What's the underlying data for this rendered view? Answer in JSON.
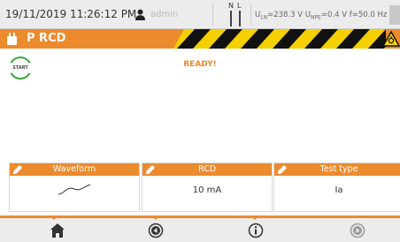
{
  "status_bar": {
    "datetime": "19/11/2019 11:26:12 PM",
    "user": "admin",
    "n_label": "N",
    "l_label": "L",
    "uln_label": "U",
    "uln_sub": "LN",
    "uln_value": "=238.3 V",
    "unpe_label": "U",
    "unpe_sub": "NPE",
    "unpe_value": "=0.4 V",
    "freq": "f=50.0 Hz"
  },
  "title_bar": {
    "title": "P RCD"
  },
  "main": {
    "start_label": "START",
    "status_text": "READY!"
  },
  "params": [
    {
      "label": "Waveform",
      "value": ""
    },
    {
      "label": "RCD",
      "value": "10 mA"
    },
    {
      "label": "Test type",
      "value": "Ia"
    }
  ],
  "colors": {
    "accent": "#ec8b2e",
    "start_ring": "#3da83d",
    "hazard_black": "#111111",
    "hazard_yellow": "#f4d000"
  }
}
